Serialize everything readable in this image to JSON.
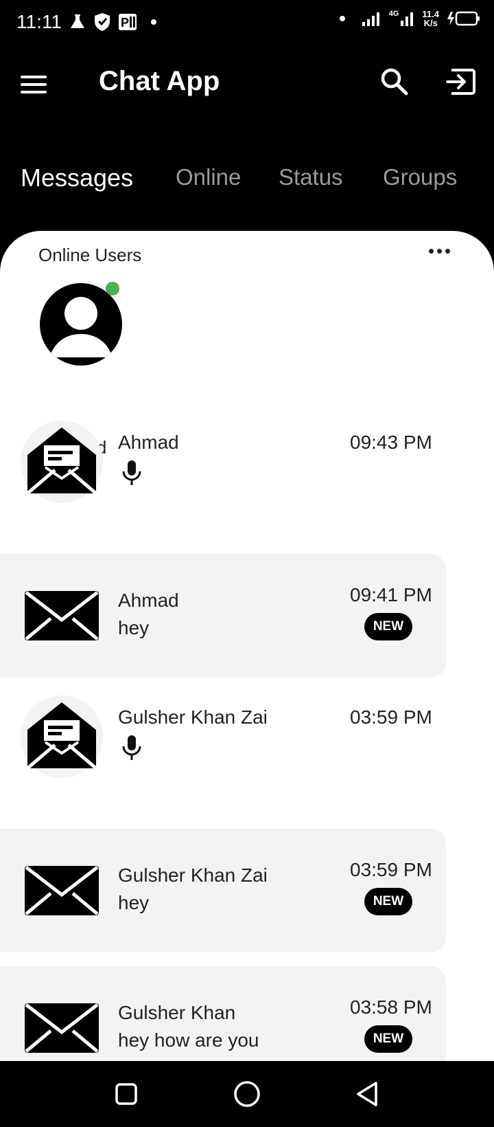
{
  "status_bar": {
    "time": "11:11",
    "network_type": "4G",
    "speed_value": "11.4",
    "speed_unit": "K/s",
    "icons": [
      "lab-flask-icon",
      "shield-icon",
      "parking-icon",
      "dot-icon",
      "signal-icon",
      "battery-charging-icon"
    ]
  },
  "app_bar": {
    "title": "Chat App",
    "icons": [
      "menu-icon",
      "search-icon",
      "logout-icon"
    ]
  },
  "tabs": [
    {
      "label": "Messages",
      "active": true
    },
    {
      "label": "Online",
      "active": false
    },
    {
      "label": "Status",
      "active": false
    },
    {
      "label": "Groups",
      "active": false
    }
  ],
  "online_section": {
    "header": "Online Users",
    "users": [
      {
        "name": "Ahmad",
        "status_color": "#4caf50"
      }
    ]
  },
  "chats": [
    {
      "name": "Ahmad",
      "time": "09:43 PM",
      "message": "",
      "voice": true,
      "new": false,
      "icon": "envelope-open-icon"
    },
    {
      "name": "Ahmad",
      "time": "09:41 PM",
      "message": "hey",
      "voice": false,
      "new": true,
      "badge": "NEW",
      "icon": "envelope-closed-icon"
    },
    {
      "name": "Gulsher Khan Zai",
      "time": "03:59 PM",
      "message": "",
      "voice": true,
      "new": false,
      "icon": "envelope-open-icon"
    },
    {
      "name": "Gulsher Khan Zai",
      "time": "03:59 PM",
      "message": "hey",
      "voice": false,
      "new": true,
      "badge": "NEW",
      "icon": "envelope-closed-icon"
    },
    {
      "name": "Gulsher Khan",
      "time": "03:58 PM",
      "message": "hey how are you",
      "voice": false,
      "new": true,
      "badge": "NEW",
      "icon": "envelope-closed-icon"
    }
  ],
  "colors": {
    "background": "#000000",
    "sheet": "#ffffff",
    "highlight_row": "#f3f3f3",
    "online_dot": "#4caf50",
    "inactive_tab": "#9a9a9a"
  }
}
